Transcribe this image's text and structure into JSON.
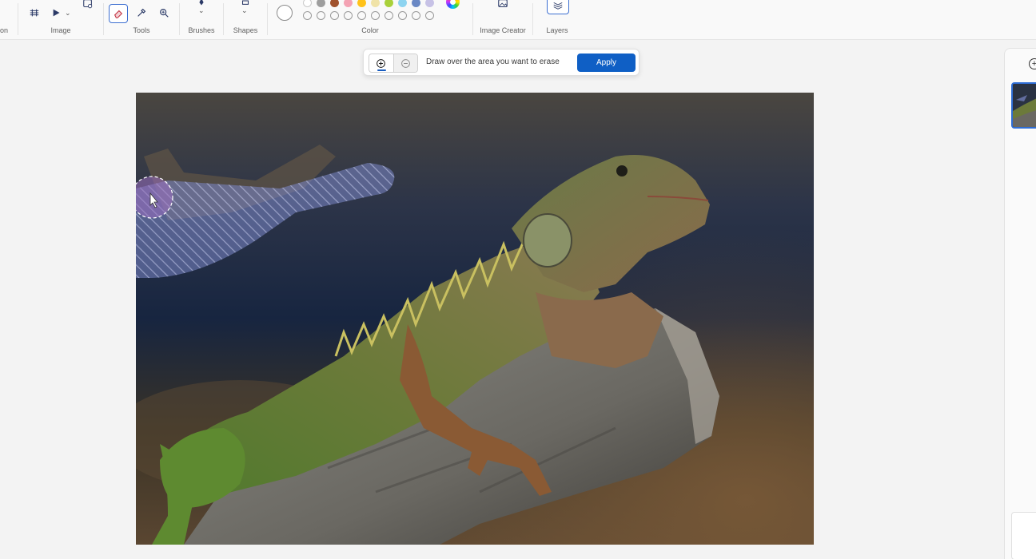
{
  "ribbon": {
    "groups": {
      "cut_label": "on",
      "image_label": "Image",
      "tools_label": "Tools",
      "brushes_label": "Brushes",
      "shapes_label": "Shapes",
      "color_label": "Color",
      "image_creator_label": "Image Creator",
      "layers_label": "Layers"
    },
    "colors": {
      "primary": "#ffffff",
      "row1": [
        "#ffffff",
        "#9e9e9e",
        "#a0522d",
        "#f4a3b4",
        "#ffc21a",
        "#f0e3a8",
        "#a9d13b",
        "#8ed4f0",
        "#6a88c4",
        "#c7c2e6"
      ],
      "row2_empty_slots": 10
    },
    "active_tool": "eraser"
  },
  "erase_bar": {
    "instruction": "Draw over the area you want to erase",
    "apply_label": "Apply",
    "mode": "add"
  },
  "canvas": {
    "subject": "iguana on branch"
  },
  "layers_panel": {
    "add_icon": "add-layer-icon"
  }
}
